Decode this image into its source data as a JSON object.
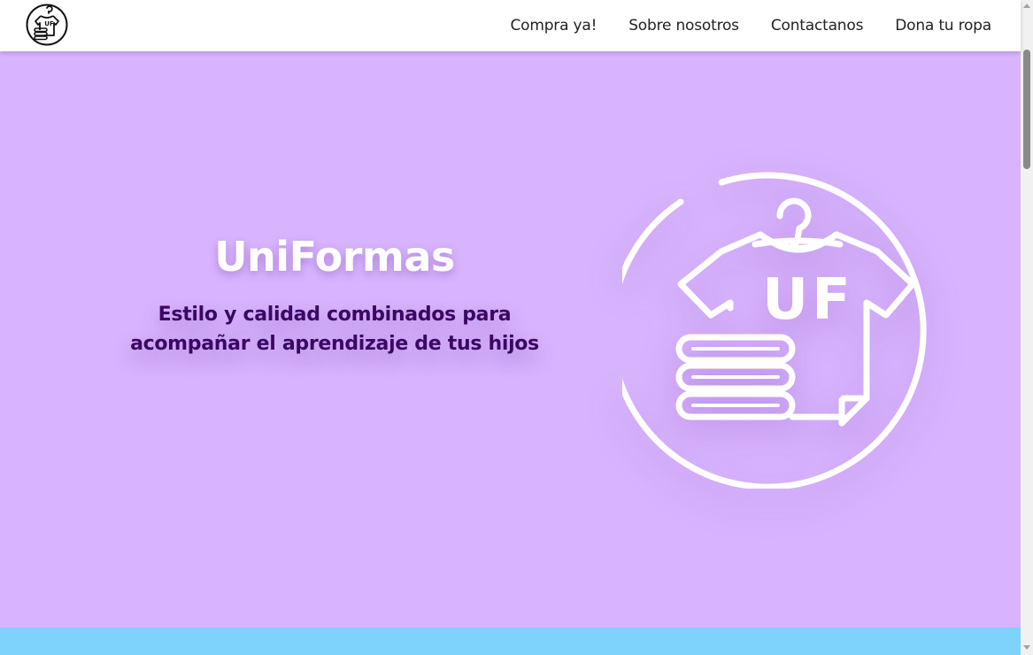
{
  "nav": {
    "logo_icon": "uniformas-logo-icon",
    "links": [
      {
        "label": "Compra ya!"
      },
      {
        "label": "Sobre nosotros"
      },
      {
        "label": "Contactanos"
      },
      {
        "label": "Dona tu ropa"
      }
    ]
  },
  "hero": {
    "title": "UniFormas",
    "subtitle_line1": "Estilo y calidad combinados para",
    "subtitle_line2": "acompañar el aprendizaje de tus hijos",
    "illustration_icon": "shirt-hanger-folded-clothes-icon",
    "illustration_badge": "UF",
    "logo_badge": "UF"
  },
  "colors": {
    "hero_background": "#d8b4fe",
    "hero_title": "#ffffff",
    "hero_subtitle": "#3b0764",
    "next_section_background": "#7dd3fc",
    "nav_background": "#ffffff",
    "nav_text": "#222222"
  }
}
